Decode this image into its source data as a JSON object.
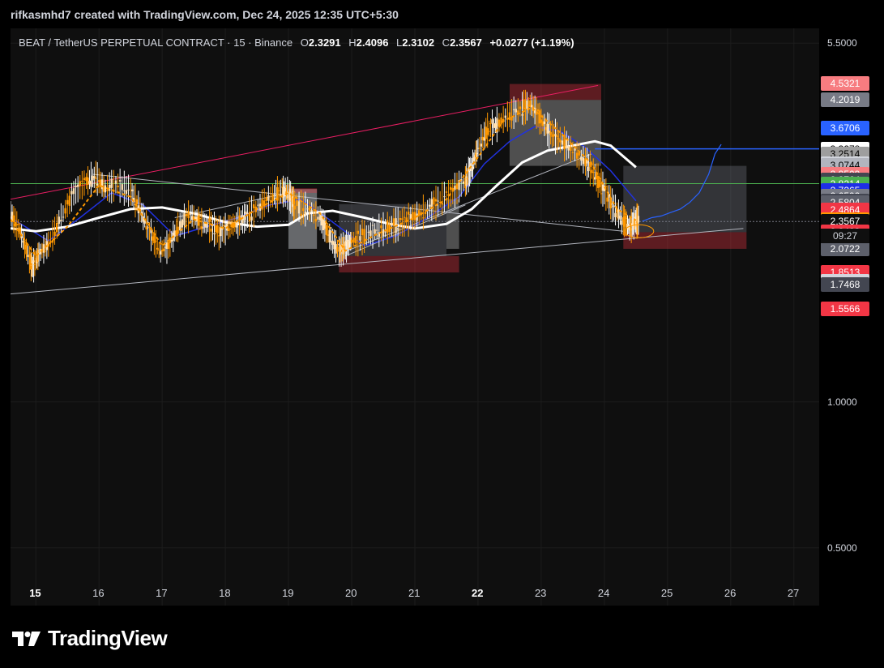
{
  "credit": "rifkasmhd7 created with TradingView.com, Dec 24, 2025 12:35 UTC+5:30",
  "header": {
    "symbol": "BEAT / TetherUS PERPETUAL CONTRACT · 15 · Binance",
    "o_label": "O",
    "o_value": "2.3291",
    "h_label": "H",
    "h_value": "2.4096",
    "l_label": "L",
    "l_value": "2.3102",
    "c_label": "C",
    "c_value": "2.3567",
    "change": "+0.0277 (+1.19%)"
  },
  "brand": {
    "name": "TradingView",
    "icon": "tradingview-logo-icon"
  },
  "countdown": "09:27",
  "chart_data": {
    "type": "candlestick",
    "y_scale": "log",
    "ylim": [
      0.38,
      5.9
    ],
    "xlim": [
      14.6,
      27.4
    ],
    "x_ticks": [
      {
        "day": 15,
        "label": "15",
        "bold": true
      },
      {
        "day": 16,
        "label": "16",
        "bold": false
      },
      {
        "day": 17,
        "label": "17",
        "bold": false
      },
      {
        "day": 18,
        "label": "18",
        "bold": false
      },
      {
        "day": 19,
        "label": "19",
        "bold": false
      },
      {
        "day": 20,
        "label": "20",
        "bold": false
      },
      {
        "day": 21,
        "label": "21",
        "bold": false
      },
      {
        "day": 22,
        "label": "22",
        "bold": true
      },
      {
        "day": 23,
        "label": "23",
        "bold": false
      },
      {
        "day": 24,
        "label": "24",
        "bold": false
      },
      {
        "day": 25,
        "label": "25",
        "bold": false
      },
      {
        "day": 26,
        "label": "26",
        "bold": false
      },
      {
        "day": 27,
        "label": "27",
        "bold": false
      }
    ],
    "y_ticks": [
      {
        "value": 5.5,
        "label": "5.5000"
      },
      {
        "value": 1.0,
        "label": "1.0000"
      },
      {
        "value": 0.5,
        "label": "0.5000"
      }
    ],
    "price_tags": [
      {
        "value": 4.5321,
        "label": "4.5321",
        "bg": "#f77c80",
        "fg": "#ffffff"
      },
      {
        "value": 4.2019,
        "label": "4.2019",
        "bg": "#787b86",
        "fg": "#ffffff"
      },
      {
        "value": 3.6706,
        "label": "3.6706",
        "bg": "#2962ff",
        "fg": "#ffffff"
      },
      {
        "value": 3.3278,
        "label": "3.3278",
        "bg": "#ffffff",
        "fg": "#000000"
      },
      {
        "value": 3.2514,
        "label": "3.2514",
        "bg": "#9e9e9e",
        "fg": "#000000"
      },
      {
        "value": 3.1019,
        "label": "3.1019",
        "bg": "#d1d4dc",
        "fg": "#000000"
      },
      {
        "value": 3.0744,
        "label": "3.0744",
        "bg": "#b2b5be",
        "fg": "#000000"
      },
      {
        "value": 2.9509,
        "label": "2.9509",
        "bg": "#f77c80",
        "fg": "#ffffff"
      },
      {
        "value": 2.8764,
        "label": "2.8764",
        "bg": "#434651",
        "fg": "#ffffff"
      },
      {
        "value": 2.8214,
        "label": "2.8214",
        "bg": "#4caf50",
        "fg": "#ffffff"
      },
      {
        "value": 2.7265,
        "label": "2.7265",
        "bg": "#1e2ee6",
        "fg": "#ffffff"
      },
      {
        "value": 2.6592,
        "label": "2.6592",
        "bg": "#787b86",
        "fg": "#ffffff"
      },
      {
        "value": 2.5942,
        "label": "2.5942",
        "bg": "#434651",
        "fg": "#ffffff"
      },
      {
        "value": 2.5804,
        "label": "2.5804",
        "bg": "#5d606b",
        "fg": "#ffffff"
      },
      {
        "value": 2.4864,
        "label": "2.4864",
        "bg": "#f23645",
        "fg": "#ffffff"
      },
      {
        "value": 2.3748,
        "label": "2.3748",
        "bg": "#ff9800",
        "fg": "#ffffff"
      },
      {
        "value": 2.3567,
        "label": "2.3567",
        "bg": "#0f0f0f",
        "fg": "#ffffff"
      },
      {
        "value": 2.2433,
        "label": "2.2433",
        "bg": "#f23645",
        "fg": "#ffffff"
      },
      {
        "value": 2.0722,
        "label": "2.0722",
        "bg": "#5d606b",
        "fg": "#ffffff"
      },
      {
        "value": 1.8513,
        "label": "1.8513",
        "bg": "#f23645",
        "fg": "#ffffff"
      },
      {
        "value": 1.7759,
        "label": "1.7759",
        "bg": "#d1d4dc",
        "fg": "#000000"
      },
      {
        "value": 1.7468,
        "label": "1.7468",
        "bg": "#434651",
        "fg": "#ffffff"
      },
      {
        "value": 1.5566,
        "label": "1.5566",
        "bg": "#f23645",
        "fg": "#ffffff"
      }
    ],
    "price_path": [
      [
        14.6,
        2.45
      ],
      [
        14.75,
        2.25
      ],
      [
        14.9,
        1.97
      ],
      [
        14.95,
        1.9
      ],
      [
        15.05,
        2.02
      ],
      [
        15.2,
        2.12
      ],
      [
        15.4,
        2.4
      ],
      [
        15.6,
        2.7
      ],
      [
        15.8,
        2.86
      ],
      [
        15.95,
        2.92
      ],
      [
        16.1,
        2.76
      ],
      [
        16.3,
        2.82
      ],
      [
        16.5,
        2.72
      ],
      [
        16.65,
        2.5
      ],
      [
        16.8,
        2.25
      ],
      [
        16.95,
        2.06
      ],
      [
        17.1,
        2.1
      ],
      [
        17.25,
        2.3
      ],
      [
        17.45,
        2.44
      ],
      [
        17.6,
        2.36
      ],
      [
        17.75,
        2.32
      ],
      [
        17.9,
        2.24
      ],
      [
        18.05,
        2.3
      ],
      [
        18.2,
        2.35
      ],
      [
        18.35,
        2.42
      ],
      [
        18.55,
        2.54
      ],
      [
        18.75,
        2.67
      ],
      [
        18.9,
        2.73
      ],
      [
        19.0,
        2.7
      ],
      [
        19.1,
        2.55
      ],
      [
        19.3,
        2.5
      ],
      [
        19.5,
        2.4
      ],
      [
        19.65,
        2.2
      ],
      [
        19.8,
        2.05
      ],
      [
        19.9,
        2.09
      ],
      [
        20.0,
        2.16
      ],
      [
        20.2,
        2.2
      ],
      [
        20.4,
        2.26
      ],
      [
        20.6,
        2.3
      ],
      [
        20.8,
        2.35
      ],
      [
        21.0,
        2.42
      ],
      [
        21.2,
        2.5
      ],
      [
        21.4,
        2.62
      ],
      [
        21.6,
        2.72
      ],
      [
        21.8,
        2.86
      ],
      [
        21.9,
        3.05
      ],
      [
        22.0,
        3.35
      ],
      [
        22.15,
        3.65
      ],
      [
        22.3,
        3.75
      ],
      [
        22.5,
        3.92
      ],
      [
        22.7,
        4.05
      ],
      [
        22.85,
        4.12
      ],
      [
        23.0,
        3.8
      ],
      [
        23.15,
        3.6
      ],
      [
        23.3,
        3.48
      ],
      [
        23.5,
        3.3
      ],
      [
        23.7,
        3.14
      ],
      [
        23.85,
        2.95
      ],
      [
        24.0,
        2.72
      ],
      [
        24.15,
        2.52
      ],
      [
        24.3,
        2.38
      ],
      [
        24.4,
        2.29
      ],
      [
        24.48,
        2.36
      ],
      [
        24.55,
        2.38
      ]
    ],
    "projection_path": [
      [
        24.6,
        2.36
      ],
      [
        24.75,
        2.4
      ],
      [
        24.9,
        2.42
      ],
      [
        25.05,
        2.46
      ],
      [
        25.2,
        2.5
      ],
      [
        25.35,
        2.58
      ],
      [
        25.5,
        2.7
      ],
      [
        25.65,
        2.95
      ],
      [
        25.75,
        3.25
      ],
      [
        25.85,
        3.4
      ]
    ],
    "ma_white": [
      [
        14.6,
        2.28
      ],
      [
        15.0,
        2.25
      ],
      [
        15.5,
        2.3
      ],
      [
        16.0,
        2.4
      ],
      [
        16.5,
        2.5
      ],
      [
        17.0,
        2.52
      ],
      [
        17.5,
        2.45
      ],
      [
        18.0,
        2.35
      ],
      [
        18.5,
        2.3
      ],
      [
        19.0,
        2.32
      ],
      [
        19.3,
        2.45
      ],
      [
        19.7,
        2.48
      ],
      [
        20.2,
        2.4
      ],
      [
        20.6,
        2.33
      ],
      [
        21.0,
        2.28
      ],
      [
        21.5,
        2.33
      ],
      [
        21.9,
        2.5
      ],
      [
        22.3,
        2.8
      ],
      [
        22.7,
        3.12
      ],
      [
        23.1,
        3.3
      ],
      [
        23.5,
        3.38
      ],
      [
        23.85,
        3.45
      ],
      [
        24.1,
        3.38
      ],
      [
        24.5,
        3.05
      ]
    ],
    "ma_blue": [
      [
        14.6,
        2.4
      ],
      [
        15.2,
        2.15
      ],
      [
        15.7,
        2.4
      ],
      [
        16.2,
        2.7
      ],
      [
        16.7,
        2.55
      ],
      [
        17.2,
        2.2
      ],
      [
        17.7,
        2.3
      ],
      [
        18.2,
        2.4
      ],
      [
        18.7,
        2.55
      ],
      [
        19.2,
        2.62
      ],
      [
        19.7,
        2.35
      ],
      [
        20.2,
        2.1
      ],
      [
        20.7,
        2.2
      ],
      [
        21.2,
        2.4
      ],
      [
        21.7,
        2.65
      ],
      [
        22.1,
        3.1
      ],
      [
        22.5,
        3.45
      ],
      [
        22.9,
        3.7
      ],
      [
        23.3,
        3.62
      ],
      [
        23.7,
        3.35
      ],
      [
        24.1,
        3.0
      ],
      [
        24.5,
        2.6
      ]
    ],
    "ma_orange": [
      [
        14.6,
        2.38
      ],
      [
        15.0,
        2.0
      ],
      [
        15.5,
        2.3
      ],
      [
        16.0,
        2.8
      ],
      [
        16.5,
        2.65
      ],
      [
        17.0,
        2.1
      ],
      [
        17.5,
        2.38
      ],
      [
        18.0,
        2.28
      ],
      [
        18.5,
        2.5
      ],
      [
        19.0,
        2.7
      ],
      [
        19.5,
        2.45
      ],
      [
        19.9,
        2.05
      ],
      [
        20.4,
        2.22
      ],
      [
        21.0,
        2.4
      ],
      [
        21.5,
        2.62
      ],
      [
        22.0,
        3.2
      ],
      [
        22.4,
        3.8
      ],
      [
        22.85,
        4.05
      ],
      [
        23.3,
        3.6
      ],
      [
        23.8,
        3.1
      ],
      [
        24.2,
        2.5
      ],
      [
        24.5,
        2.37
      ]
    ],
    "levels": [
      {
        "value": 2.8214,
        "color": "#4caf50"
      },
      {
        "value": 3.3278,
        "color": "#2962ff"
      },
      {
        "value": 2.3567,
        "color": "#787b86"
      }
    ],
    "trendlines": [
      {
        "x1": 14.6,
        "y1": 2.62,
        "x2": 23.9,
        "y2": 4.5,
        "color": "#e91e63"
      },
      {
        "x1": 14.6,
        "y1": 1.67,
        "x2": 26.2,
        "y2": 2.28,
        "color": "#b2b5be"
      },
      {
        "x1": 15.9,
        "y1": 2.95,
        "x2": 24.3,
        "y2": 2.25,
        "color": "#b2b5be"
      },
      {
        "x1": 17.2,
        "y1": 2.4,
        "x2": 19.1,
        "y2": 2.72,
        "color": "#b2b5be"
      },
      {
        "x1": 19.8,
        "y1": 2.02,
        "x2": 23.8,
        "y2": 3.25,
        "color": "#b2b5be"
      },
      {
        "x1": 19.9,
        "y1": 2.0,
        "x2": 21.8,
        "y2": 2.55,
        "color": "#b2b5be"
      }
    ],
    "zones": [
      {
        "x1": 19.0,
        "y1": 2.07,
        "x2": 19.45,
        "y2": 2.75,
        "color": "#d1d4dc",
        "opacity": 0.45
      },
      {
        "x1": 19.0,
        "y1": 2.7,
        "x2": 19.45,
        "y2": 2.76,
        "color": "#f23645",
        "opacity": 0.35
      },
      {
        "x1": 19.8,
        "y1": 1.85,
        "x2": 21.7,
        "y2": 2.0,
        "color": "#f23645",
        "opacity": 0.35
      },
      {
        "x1": 19.8,
        "y1": 2.0,
        "x2": 21.5,
        "y2": 2.56,
        "color": "#787b86",
        "opacity": 0.35
      },
      {
        "x1": 21.5,
        "y1": 2.07,
        "x2": 21.7,
        "y2": 2.62,
        "color": "#9e9e9e",
        "opacity": 0.45
      },
      {
        "x1": 22.5,
        "y1": 4.2,
        "x2": 23.95,
        "y2": 4.53,
        "color": "#f23645",
        "opacity": 0.35
      },
      {
        "x1": 22.5,
        "y1": 3.07,
        "x2": 23.95,
        "y2": 4.2,
        "color": "#9e9e9e",
        "opacity": 0.45
      },
      {
        "x1": 24.3,
        "y1": 2.24,
        "x2": 26.25,
        "y2": 3.07,
        "color": "#787b86",
        "opacity": 0.35
      },
      {
        "x1": 24.3,
        "y1": 2.07,
        "x2": 26.25,
        "y2": 2.24,
        "color": "#f23645",
        "opacity": 0.35
      }
    ]
  }
}
